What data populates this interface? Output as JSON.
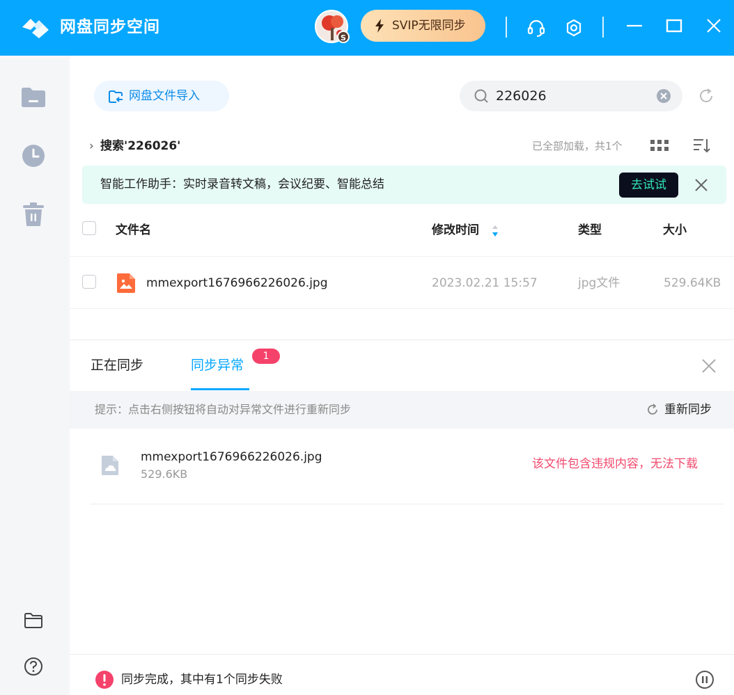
{
  "app": {
    "title": "网盘同步空间",
    "avatar_badge": "S",
    "vip_label": "SVIP无限同步",
    "icons": [
      "app-logo-icon",
      "headset-icon",
      "settings-icon",
      "minimize-icon",
      "maximize-icon",
      "close-icon"
    ],
    "accent": "#06a7ff"
  },
  "sidebar": {
    "items": [
      {
        "name": "my-files",
        "icon": "folder-icon"
      },
      {
        "name": "recent",
        "icon": "clock-icon"
      },
      {
        "name": "trash",
        "icon": "trash-icon"
      }
    ],
    "bottom_items": [
      {
        "name": "open-folder",
        "icon": "folder-outline-icon"
      },
      {
        "name": "help",
        "icon": "help-icon"
      }
    ]
  },
  "toolbar": {
    "import_label": "网盘文件导入",
    "search_value": "226026"
  },
  "breadcrumb": {
    "label": "搜索'226026'"
  },
  "list_status": "已全部加载，共1个",
  "banner": {
    "text": "智能工作助手：实时录音转文稿，会议纪要、智能总结",
    "button": "去试试"
  },
  "table": {
    "columns": [
      "文件名",
      "修改时间",
      "类型",
      "大小"
    ],
    "rows": [
      {
        "name": "mmexport1676966226026.jpg",
        "modified": "2023.02.21 15:57",
        "type": "jpg文件",
        "size": "529.64KB"
      }
    ]
  },
  "sync_panel": {
    "tabs": [
      {
        "label": "正在同步",
        "active": false
      },
      {
        "label": "同步异常",
        "active": true,
        "badge": "1"
      }
    ],
    "hint": "提示：点击右侧按钮将自动对异常文件进行重新同步",
    "resync_label": "重新同步",
    "errors": [
      {
        "name": "mmexport1676966226026.jpg",
        "size": "529.6KB",
        "message": "该文件包含违规内容，无法下载"
      }
    ]
  },
  "footer": {
    "status": "同步完成，其中有1个同步失败"
  }
}
